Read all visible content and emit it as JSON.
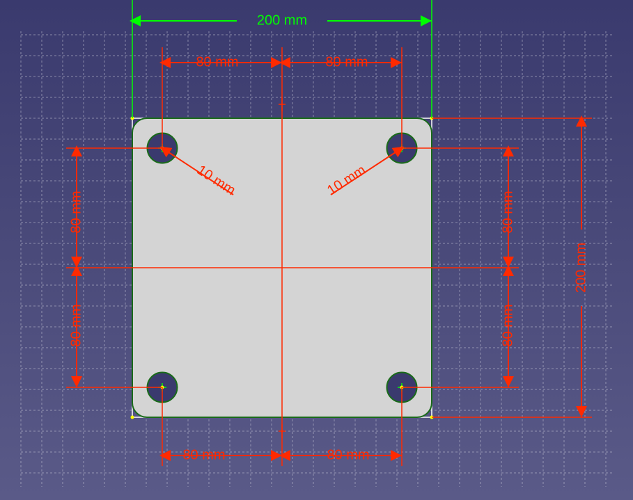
{
  "sketch": {
    "part": {
      "width_mm": 200,
      "height_mm": 200,
      "corner_radius_mm": 10,
      "hole_radius_mm": 10,
      "hole_offset_mm": 80
    },
    "dimensions": {
      "top_overall": "200 mm",
      "right_overall": "200 mm",
      "top_left_80": "80 mm",
      "top_right_80": "80 mm",
      "bottom_left_80": "80 mm",
      "bottom_right_80": "80 mm",
      "left_upper_80": "80 mm",
      "left_lower_80": "80 mm",
      "right_upper_80": "80 mm",
      "right_lower_80": "80 mm",
      "radius_left": "10 mm",
      "radius_right": "10 mm"
    }
  }
}
